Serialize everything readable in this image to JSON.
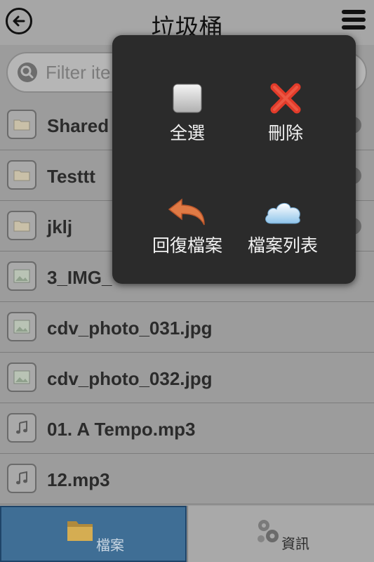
{
  "header": {
    "title": "垃圾桶"
  },
  "search": {
    "placeholder": "Filter ite"
  },
  "files": [
    {
      "name": "Shared",
      "type": "folder"
    },
    {
      "name": "Testtt",
      "type": "folder"
    },
    {
      "name": "jklj",
      "type": "folder"
    },
    {
      "name": "3_IMG_",
      "type": "image"
    },
    {
      "name": "cdv_photo_031.jpg",
      "type": "image"
    },
    {
      "name": "cdv_photo_032.jpg",
      "type": "image"
    },
    {
      "name": "01. A Tempo.mp3",
      "type": "audio"
    },
    {
      "name": "12.mp3",
      "type": "audio"
    }
  ],
  "popup": {
    "select_all": "全選",
    "delete": "刪除",
    "restore": "回復檔案",
    "file_list": "檔案列表"
  },
  "tabs": {
    "files": "檔案",
    "info": "資訊"
  },
  "colors": {
    "accent": "#3f6e95",
    "delete_red": "#e23b2a",
    "restore_orange": "#e07a45"
  }
}
